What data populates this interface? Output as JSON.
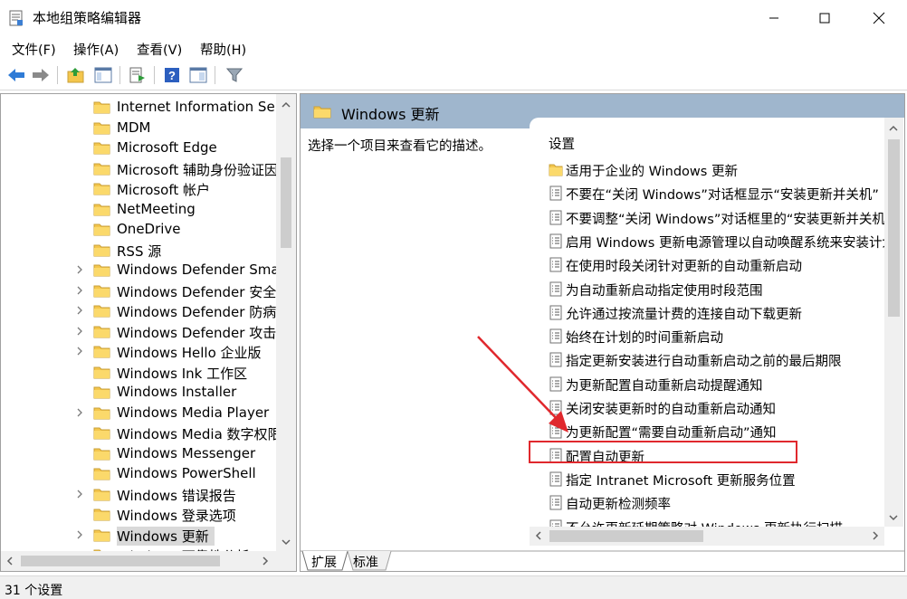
{
  "window": {
    "title": "本地组策略编辑器"
  },
  "menu": [
    {
      "label": "文件(F)"
    },
    {
      "label": "操作(A)"
    },
    {
      "label": "查看(V)"
    },
    {
      "label": "帮助(H)"
    }
  ],
  "tree": {
    "items": [
      {
        "label": "Internet Information Servi",
        "expandable": false
      },
      {
        "label": "MDM",
        "expandable": false
      },
      {
        "label": "Microsoft Edge",
        "expandable": false
      },
      {
        "label": "Microsoft 辅助身份验证因",
        "expandable": false
      },
      {
        "label": "Microsoft 帐户",
        "expandable": false
      },
      {
        "label": "NetMeeting",
        "expandable": false
      },
      {
        "label": "OneDrive",
        "expandable": false
      },
      {
        "label": "RSS 源",
        "expandable": false
      },
      {
        "label": "Windows Defender Smart",
        "expandable": true
      },
      {
        "label": "Windows Defender 安全中",
        "expandable": true
      },
      {
        "label": "Windows Defender 防病毒",
        "expandable": true
      },
      {
        "label": "Windows Defender 攻击防",
        "expandable": true
      },
      {
        "label": "Windows Hello 企业版",
        "expandable": true
      },
      {
        "label": "Windows Ink 工作区",
        "expandable": false
      },
      {
        "label": "Windows Installer",
        "expandable": false
      },
      {
        "label": "Windows Media Player",
        "expandable": true
      },
      {
        "label": "Windows Media 数字权限",
        "expandable": false
      },
      {
        "label": "Windows Messenger",
        "expandable": false
      },
      {
        "label": "Windows PowerShell",
        "expandable": false
      },
      {
        "label": "Windows 错误报告",
        "expandable": true
      },
      {
        "label": "Windows 登录选项",
        "expandable": false
      },
      {
        "label": "Windows 更新",
        "expandable": true,
        "selected": true
      },
      {
        "label": "Windows 可靠性分析",
        "expandable": false
      }
    ]
  },
  "right": {
    "header_title": "Windows 更新",
    "description": "选择一个项目来查看它的描述。",
    "column_header": "设置",
    "items": [
      {
        "label": "适用于企业的 Windows 更新",
        "type": "folder"
      },
      {
        "label": "不要在“关闭 Windows”对话框显示“安装更新并关机”",
        "type": "policy"
      },
      {
        "label": "不要调整“关闭 Windows”对话框里的“安装更新并关机”",
        "type": "policy"
      },
      {
        "label": "启用 Windows 更新电源管理以自动唤醒系统来安装计划",
        "type": "policy"
      },
      {
        "label": "在使用时段关闭针对更新的自动重新启动",
        "type": "policy"
      },
      {
        "label": "为自动重新启动指定使用时段范围",
        "type": "policy"
      },
      {
        "label": "允许通过按流量计费的连接自动下载更新",
        "type": "policy"
      },
      {
        "label": "始终在计划的时间重新启动",
        "type": "policy"
      },
      {
        "label": "指定更新安装进行自动重新启动之前的最后期限",
        "type": "policy"
      },
      {
        "label": "为更新配置自动重新启动提醒通知",
        "type": "policy"
      },
      {
        "label": "关闭安装更新时的自动重新启动通知",
        "type": "policy"
      },
      {
        "label": "为更新配置“需要自动重新启动”通知",
        "type": "policy"
      },
      {
        "label": "配置自动更新",
        "type": "policy"
      },
      {
        "label": "指定 Intranet Microsoft 更新服务位置",
        "type": "policy"
      },
      {
        "label": "自动更新检测频率",
        "type": "policy"
      },
      {
        "label": "不允许更新延期策略对 Windows 更新执行扫描",
        "type": "policy"
      }
    ],
    "tabs": [
      {
        "label": "扩展",
        "active": true
      },
      {
        "label": "标准",
        "active": false
      }
    ]
  },
  "status": {
    "text": "31 个设置"
  },
  "colors": {
    "header_bg": "#9fb6cd",
    "highlight": "#e0282d",
    "folder": "#f4c64c",
    "arrow": "#e0282d"
  }
}
